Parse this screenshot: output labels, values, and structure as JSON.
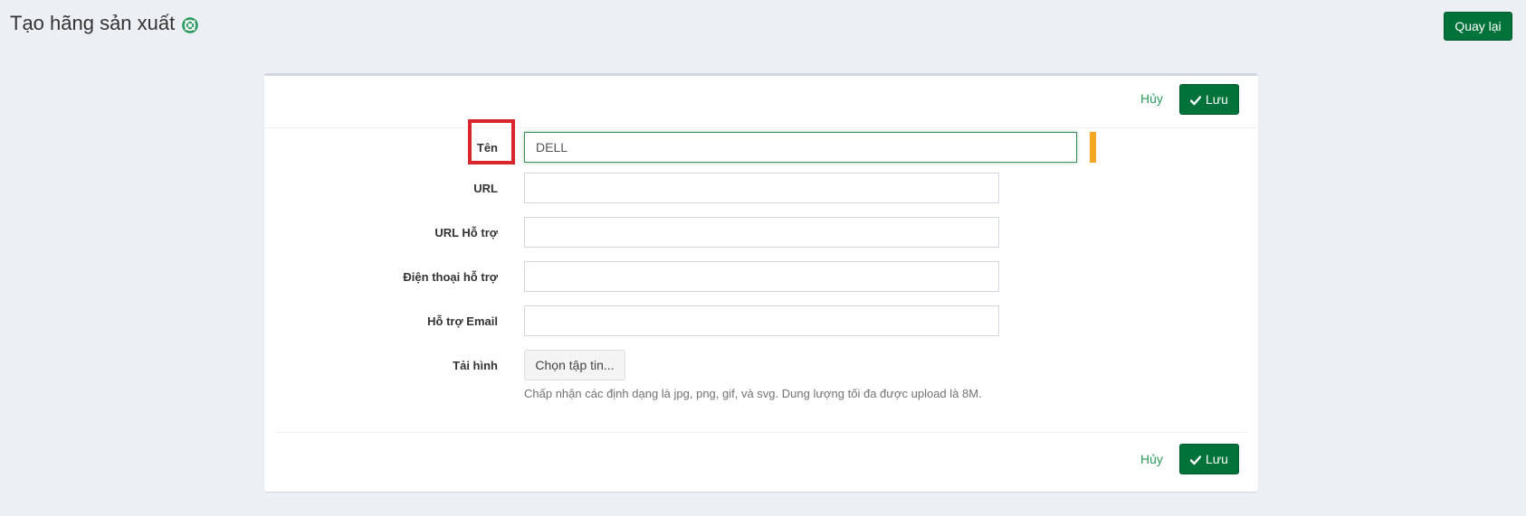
{
  "header": {
    "title": "Tạo hãng sản xuất",
    "back_label": "Quay lại"
  },
  "actions": {
    "cancel_label": "Hủy",
    "save_label": "Lưu"
  },
  "form": {
    "name": {
      "label": "Tên",
      "value": "DELL"
    },
    "url": {
      "label": "URL",
      "value": ""
    },
    "support_url": {
      "label": "URL Hỗ trợ",
      "value": ""
    },
    "support_phone": {
      "label": "Điện thoại hỗ trợ",
      "value": ""
    },
    "support_email": {
      "label": "Hỗ trợ Email",
      "value": ""
    },
    "image": {
      "label": "Tải hình",
      "button_label": "Chọn tập tin...",
      "help_text": "Chấp nhận các định dạng là jpg, png, gif, và svg. Dung lượng tối đa được upload là 8M."
    }
  },
  "colors": {
    "primary": "#00723a",
    "link": "#2a9a5c",
    "required": "#f5a623",
    "highlight": "#d9262c",
    "background": "#ecf0f5"
  }
}
